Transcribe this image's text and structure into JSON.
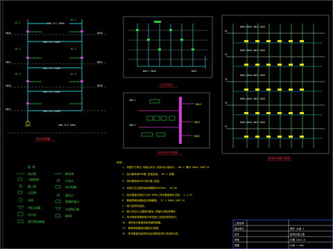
{
  "drawing": {
    "colors": {
      "background": "#000000",
      "frame": "#8a8a8a",
      "pipe_cyan": "#1fd0e0",
      "pipe_green": "#22d63a",
      "pipe_magenta": "#d23ad2",
      "text_yellow": "#f2e200",
      "text_red": "#ff3030",
      "border_blue": "#3050ff"
    },
    "panels": {
      "left_system_title": "給水系統圖",
      "top_center_title": "卫生间给水",
      "middle_center_title": "给水排水大样图",
      "right_system_title": "给排水系统示意图"
    },
    "left_labels": [
      "WL-1",
      "DN40",
      "DN32",
      "WL-2",
      "DN40",
      "WL-3",
      "DN32",
      "WL-4",
      "DN40",
      "WL-5",
      "DN32",
      "WL-6",
      "DN40"
    ],
    "legend": {
      "title": "图 例",
      "left_column": [
        "给水管",
        "二级闸阀",
        "截止阀",
        "止回阀",
        "水表",
        "Y型过滤器",
        "消火栓",
        "潜污泵控制箱"
      ],
      "right_column": [
        "DN100",
        "水龙头",
        "排水地漏",
        "清扫口",
        "管道检查口",
        "水流指示器",
        "DN50"
      ]
    },
    "notes": {
      "header": "说明:",
      "lines": [
        "1. 本图尺寸单位:标高以米计,其余均以毫米计。  WH-1  暖气    DN25   20M³/H",
        "2. 给水管采用PPR管,热熔连接。                     HV-1  供暖",
        "3. 排水管采用UPVC排水管,粘接。",
        "4. 本图卫生洁具安装参照国标09S304。    50        Ep",
        "5. 给水管道试验压力为0.6MPa,排水管做灌水试验。   1-4   2F",
        "6. 管道穿墙及楼板处设钢套管。          TC-1  DN50  20M³/H",
        "7. 阀门及附件选用。",
        "8. 施工时应与土建密切配合,预留孔洞及预埋件。",
        "9. 未尽事宜按国家现行有关施工及验收规范执行。",
        "10. 消防给水管道采用热镀锌钢管。",
        "11. 管道穿越屋面应做防水处理。",
        "12. 所有管道安装完毕后应按规范进行试压和冲洗。"
      ]
    },
    "title_block": {
      "rows": [
        [
          "工程名称",
          "",
          ""
        ],
        [
          "建设单位",
          "",
          "图号 水施-1"
        ],
        [
          "设计",
          "",
          "给排水施工图"
        ],
        [
          "审核",
          "",
          "日期 2013.8"
        ],
        [
          "制图",
          "",
          "比例 1:100"
        ]
      ]
    }
  }
}
